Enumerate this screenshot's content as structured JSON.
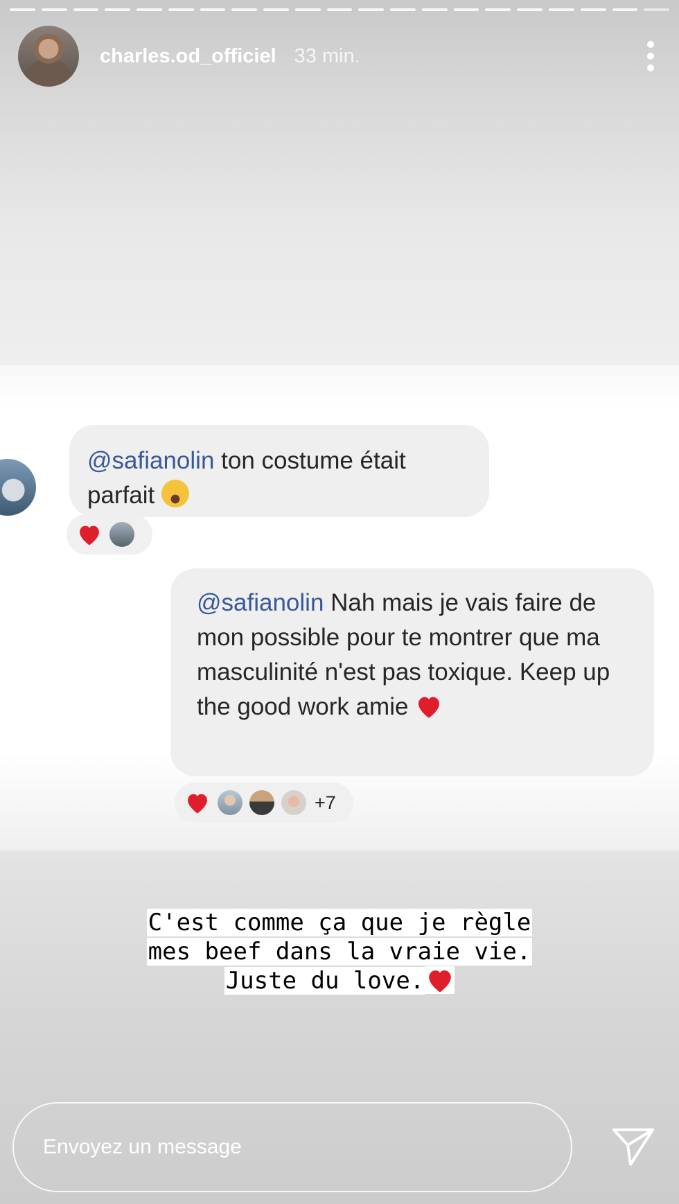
{
  "story": {
    "progress_segments": 21,
    "user": {
      "username": "charles.od_officiel",
      "time_ago": "33 min."
    }
  },
  "comments": [
    {
      "mention": "@safianolin",
      "text": "ton costume était parfait",
      "reaction_count": ""
    },
    {
      "mention": "@safianolin",
      "text": "Nah mais je vais faire de mon possible pour te montrer que ma masculinité n'est pas toxique. Keep up the good work amie",
      "reaction_more": "+7"
    }
  ],
  "caption": {
    "line1": "C'est comme ça que je règle",
    "line2": "mes beef dans la vraie vie.",
    "line3": "Juste du love."
  },
  "reply": {
    "placeholder": "Envoyez un message"
  },
  "colors": {
    "mention": "#385898",
    "heart": "#e01e2b",
    "bubble": "#efefef"
  },
  "icons": [
    "more-options-icon",
    "laughing-emoji-icon",
    "heart-icon",
    "send-icon"
  ]
}
